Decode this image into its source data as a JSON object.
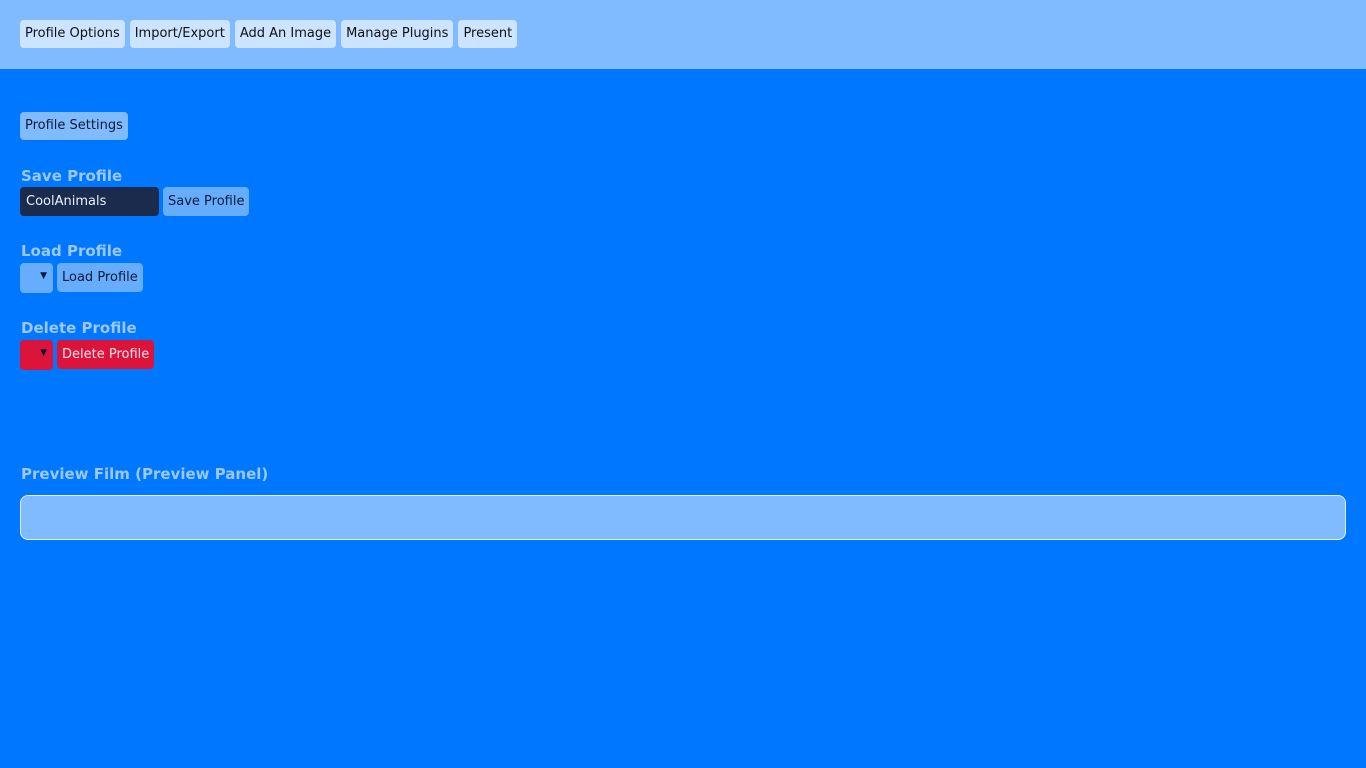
{
  "nav": {
    "items": [
      {
        "label": "Profile Options"
      },
      {
        "label": "Import/Export"
      },
      {
        "label": "Add An Image"
      },
      {
        "label": "Manage Plugins"
      },
      {
        "label": "Present"
      }
    ]
  },
  "profile_settings": {
    "button_label": "Profile Settings"
  },
  "save_profile": {
    "title": "Save Profile",
    "input_value": "CoolAnimals",
    "button_label": "Save Profile"
  },
  "load_profile": {
    "title": "Load Profile",
    "selected_value": "",
    "caret": "▼",
    "button_label": "Load Profile"
  },
  "delete_profile": {
    "title": "Delete Profile",
    "selected_value": "",
    "caret": "▼",
    "button_label": "Delete Profile"
  },
  "preview": {
    "title": "Preview Film (Preview Panel)"
  },
  "colors": {
    "background": "#0077ff",
    "topbar": "#80bbff",
    "danger": "#dc143c",
    "input_dark": "#1a2b4d"
  }
}
